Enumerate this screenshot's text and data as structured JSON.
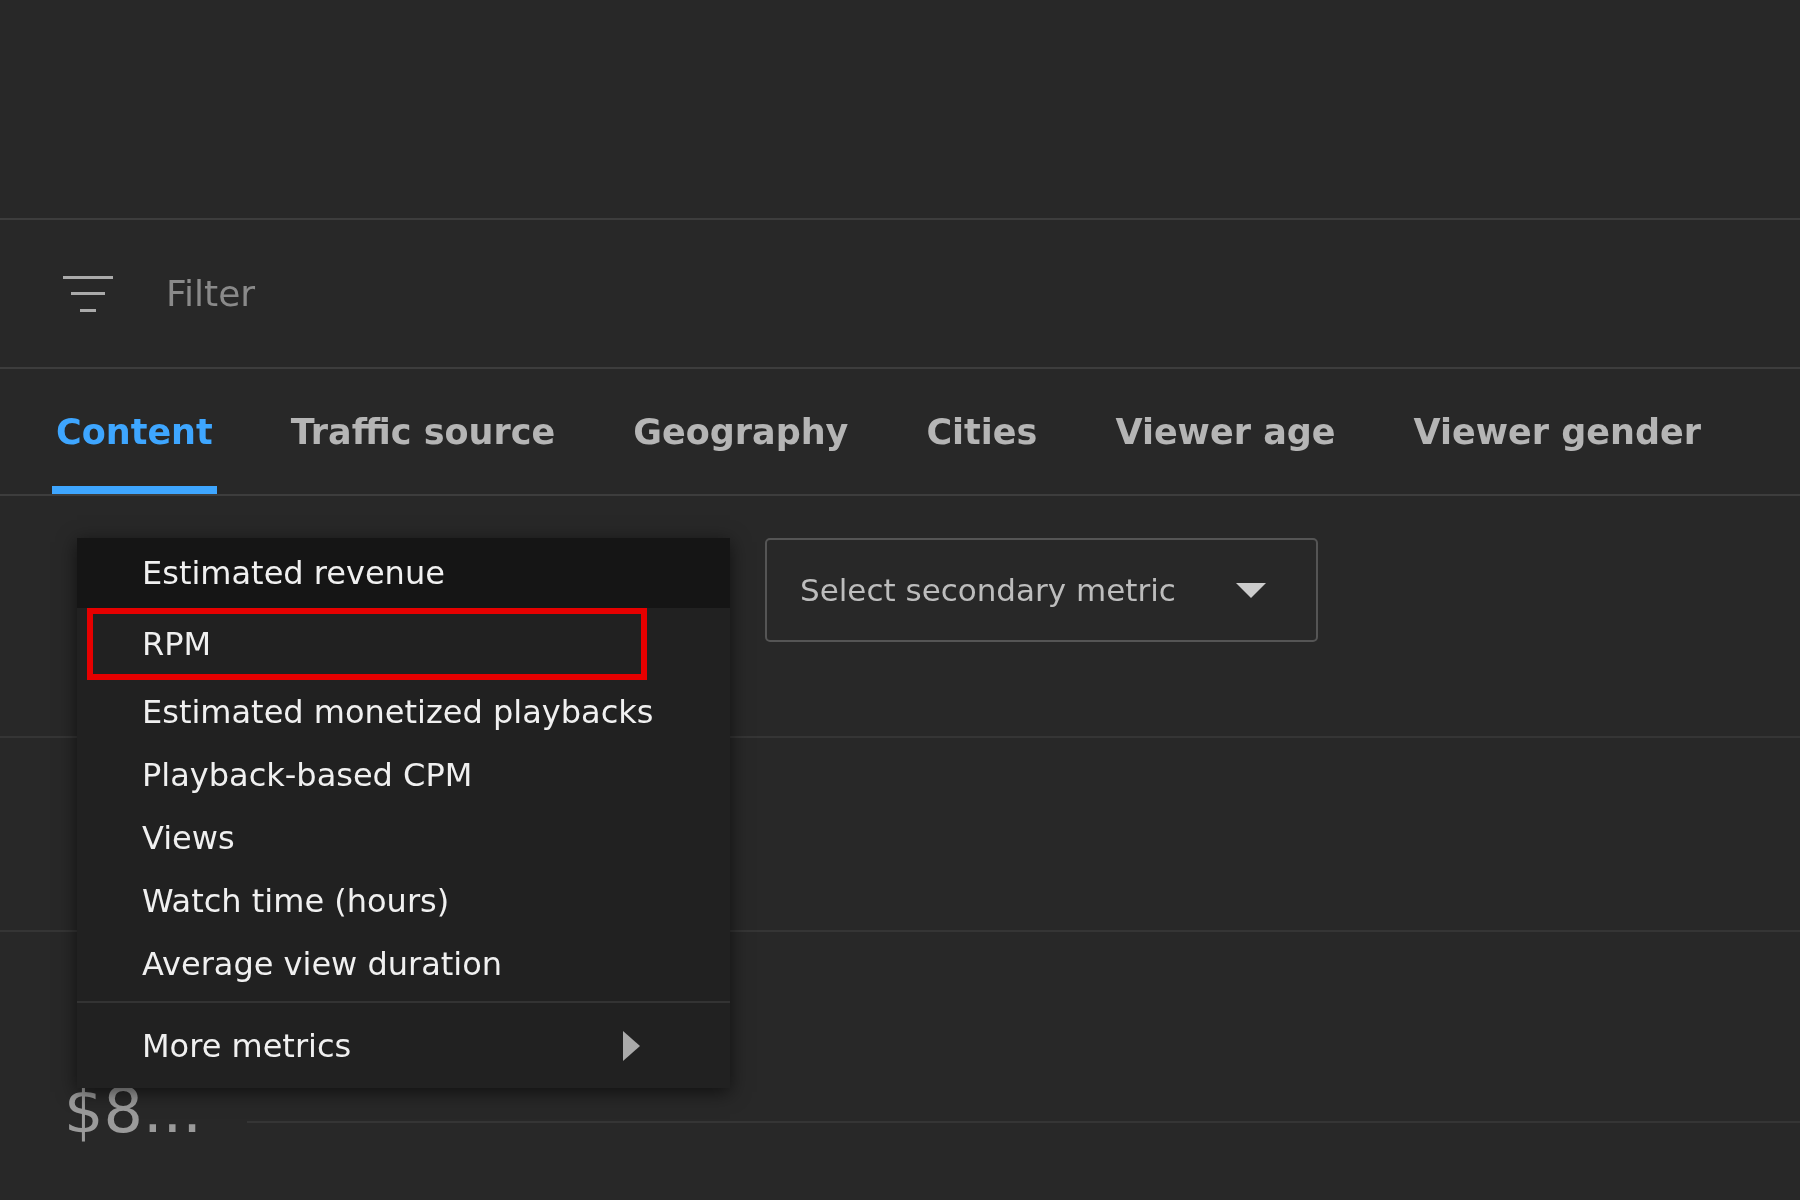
{
  "filter": {
    "placeholder": "Filter"
  },
  "tabs": [
    {
      "label": "Content",
      "selected": true
    },
    {
      "label": "Traffic source",
      "selected": false
    },
    {
      "label": "Geography",
      "selected": false
    },
    {
      "label": "Cities",
      "selected": false
    },
    {
      "label": "Viewer age",
      "selected": false
    },
    {
      "label": "Viewer gender",
      "selected": false
    }
  ],
  "metric_menu": {
    "items": [
      {
        "label": "Estimated revenue",
        "selected": true,
        "highlighted": false
      },
      {
        "label": "RPM",
        "selected": false,
        "highlighted": true
      },
      {
        "label": "Estimated monetized playbacks",
        "selected": false,
        "highlighted": false
      },
      {
        "label": "Playback-based CPM",
        "selected": false,
        "highlighted": false
      },
      {
        "label": "Views",
        "selected": false,
        "highlighted": false
      },
      {
        "label": "Watch time (hours)",
        "selected": false,
        "highlighted": false
      },
      {
        "label": "Average view duration",
        "selected": false,
        "highlighted": false
      }
    ],
    "more": {
      "label": "More metrics"
    }
  },
  "secondary_metric": {
    "placeholder": "Select secondary metric"
  },
  "stats": [
    {
      "value": "$8..."
    }
  ]
}
